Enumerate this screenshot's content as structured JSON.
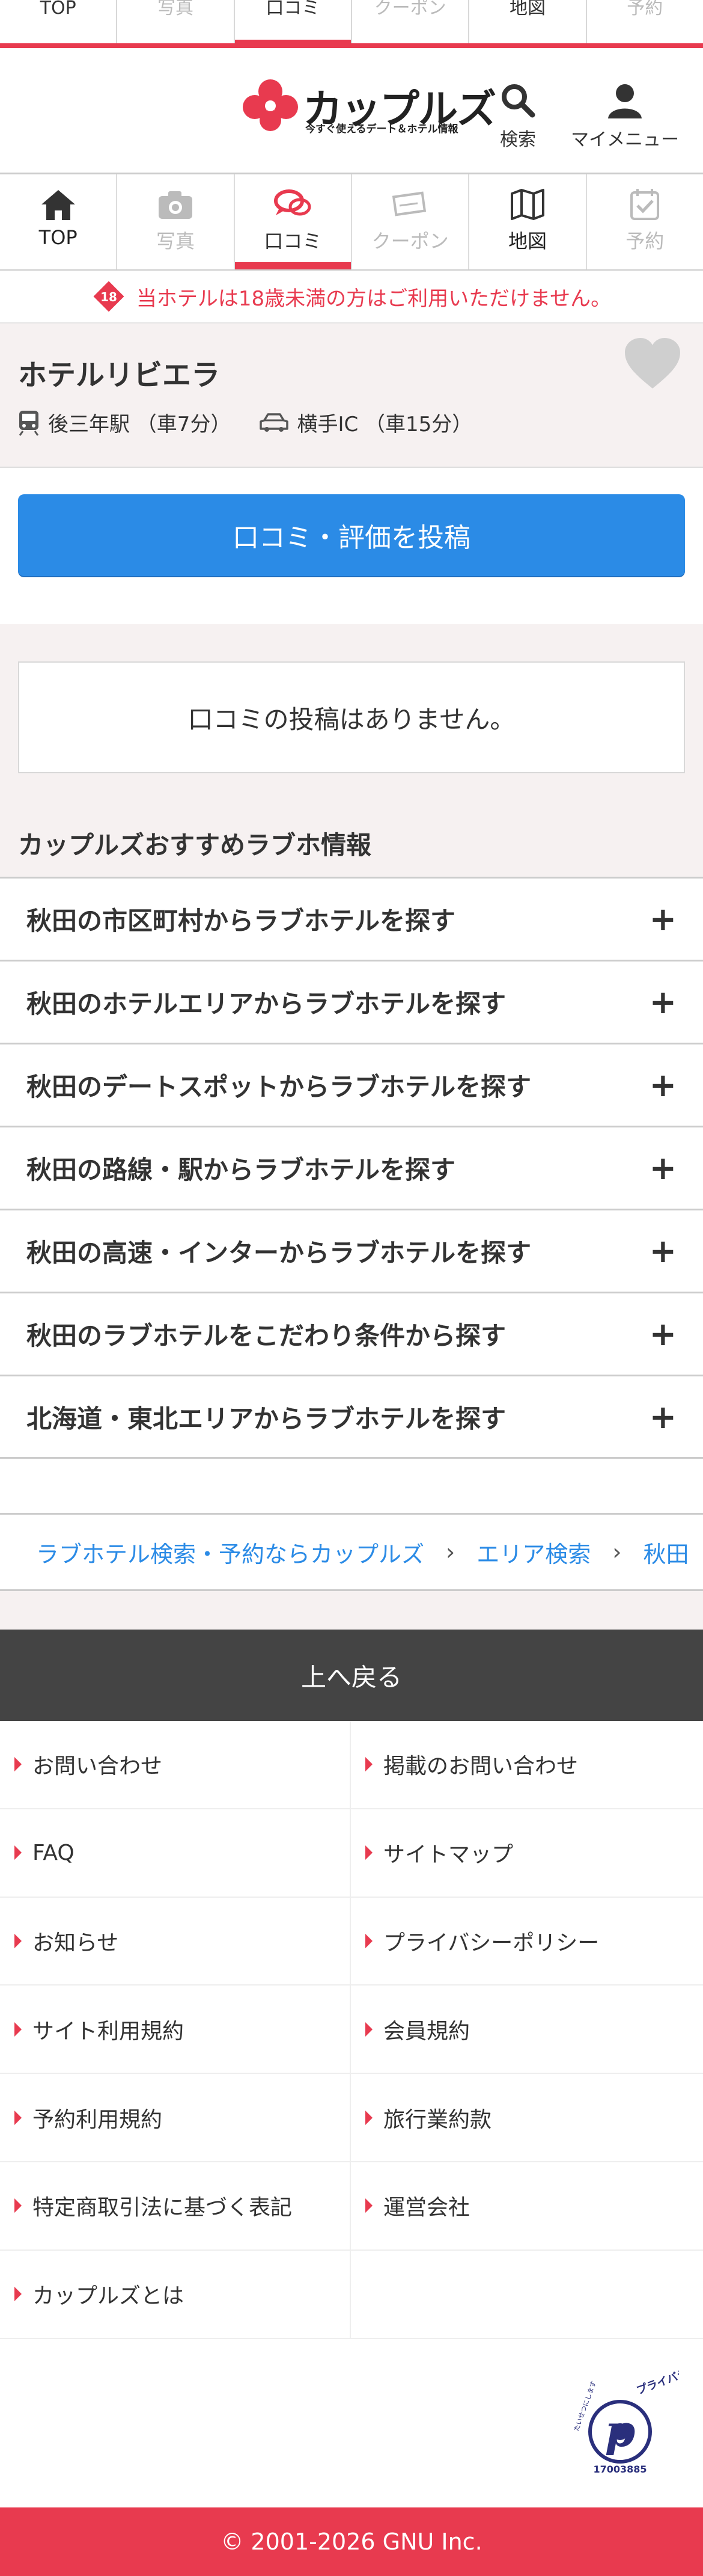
{
  "top_tabs": [
    {
      "label": "TOP",
      "state": "normal"
    },
    {
      "label": "写真",
      "state": "disabled"
    },
    {
      "label": "口コミ",
      "state": "active"
    },
    {
      "label": "クーポン",
      "state": "disabled"
    },
    {
      "label": "地図",
      "state": "normal"
    },
    {
      "label": "予約",
      "state": "disabled"
    }
  ],
  "header": {
    "brand": "カップルズ",
    "tagline": "今すぐ使えるデート＆ホテル情報",
    "search_label": "検索",
    "mymenu_label": "マイメニュー"
  },
  "nav_tabs": [
    {
      "label": "TOP",
      "icon": "home-icon",
      "state": "normal"
    },
    {
      "label": "写真",
      "icon": "camera-icon",
      "state": "disabled"
    },
    {
      "label": "口コミ",
      "icon": "speech-bubble-icon",
      "state": "active"
    },
    {
      "label": "クーポン",
      "icon": "coupon-icon",
      "state": "disabled"
    },
    {
      "label": "地図",
      "icon": "map-icon",
      "state": "normal"
    },
    {
      "label": "予約",
      "icon": "calendar-check-icon",
      "state": "disabled"
    }
  ],
  "age_warning": "当ホテルは18歳未満の方はご利用いただけません。",
  "hotel": {
    "name": "ホテルリビエラ",
    "station": "後三年駅 （車7分）",
    "ic": "横手IC （車15分）"
  },
  "post_review_label": "口コミ・評価を投稿",
  "no_reviews_text": "口コミの投稿はありません。",
  "recommend": {
    "title": "カップルズおすすめラブホ情報",
    "items": [
      "秋田の市区町村からラブホテルを探す",
      "秋田のホテルエリアからラブホテルを探す",
      "秋田のデートスポットからラブホテルを探す",
      "秋田の路線・駅からラブホテルを探す",
      "秋田の高速・インターからラブホテルを探す",
      "秋田のラブホテルをこだわり条件から探す",
      "北海道・東北エリアからラブホテルを探す"
    ]
  },
  "breadcrumb": [
    "ラブホテル検索・予約ならカップルズ",
    "エリア検索",
    "秋田"
  ],
  "back_to_top": "上へ戻る",
  "footer_links": [
    "お問い合わせ",
    "掲載のお問い合わせ",
    "FAQ",
    "サイトマップ",
    "お知らせ",
    "プライバシーポリシー",
    "サイト利用規約",
    "会員規約",
    "予約利用規約",
    "旅行業約款",
    "特定商取引法に基づく表記",
    "運営会社",
    "カップルズとは",
    ""
  ],
  "privacy_mark": {
    "text": "プライバシー",
    "number": "17003885",
    "arc_text": "たいせつにします"
  },
  "copyright": "© 2001-2026 GNU Inc.",
  "colors": {
    "accent": "#e83a4f",
    "button_blue": "#2b8be6",
    "bg_pink": "#f6f1f1"
  }
}
